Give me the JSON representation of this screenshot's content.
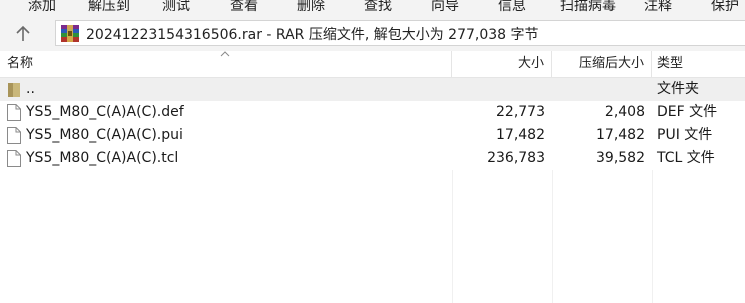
{
  "toolbar": {
    "items": [
      "添加",
      "解压到",
      "测试",
      "查看",
      "删除",
      "查找",
      "向导",
      "信息",
      "扫描病毒",
      "注释",
      "保护"
    ]
  },
  "address": {
    "text": "20241223154316506.rar - RAR 压缩文件, 解包大小为 277,038 字节"
  },
  "columns": {
    "name": "名称",
    "size": "大小",
    "packed": "压缩后大小",
    "type": "类型"
  },
  "files": [
    {
      "name": "..",
      "size": "",
      "packed": "",
      "type": "文件夹",
      "icon": "folder-icon"
    },
    {
      "name": "YS5_M80_C(A)A(C).def",
      "size": "22,773",
      "packed": "2,408",
      "type": "DEF 文件",
      "icon": "file-icon"
    },
    {
      "name": "YS5_M80_C(A)A(C).pui",
      "size": "17,482",
      "packed": "17,482",
      "type": "PUI 文件",
      "icon": "file-icon"
    },
    {
      "name": "YS5_M80_C(A)A(C).tcl",
      "size": "236,783",
      "packed": "39,582",
      "type": "TCL 文件",
      "icon": "file-icon"
    }
  ],
  "colors": {
    "toolbar_bg": "#f3f3f3",
    "selected_row": "#efefef",
    "folder": "#c9b77a"
  }
}
